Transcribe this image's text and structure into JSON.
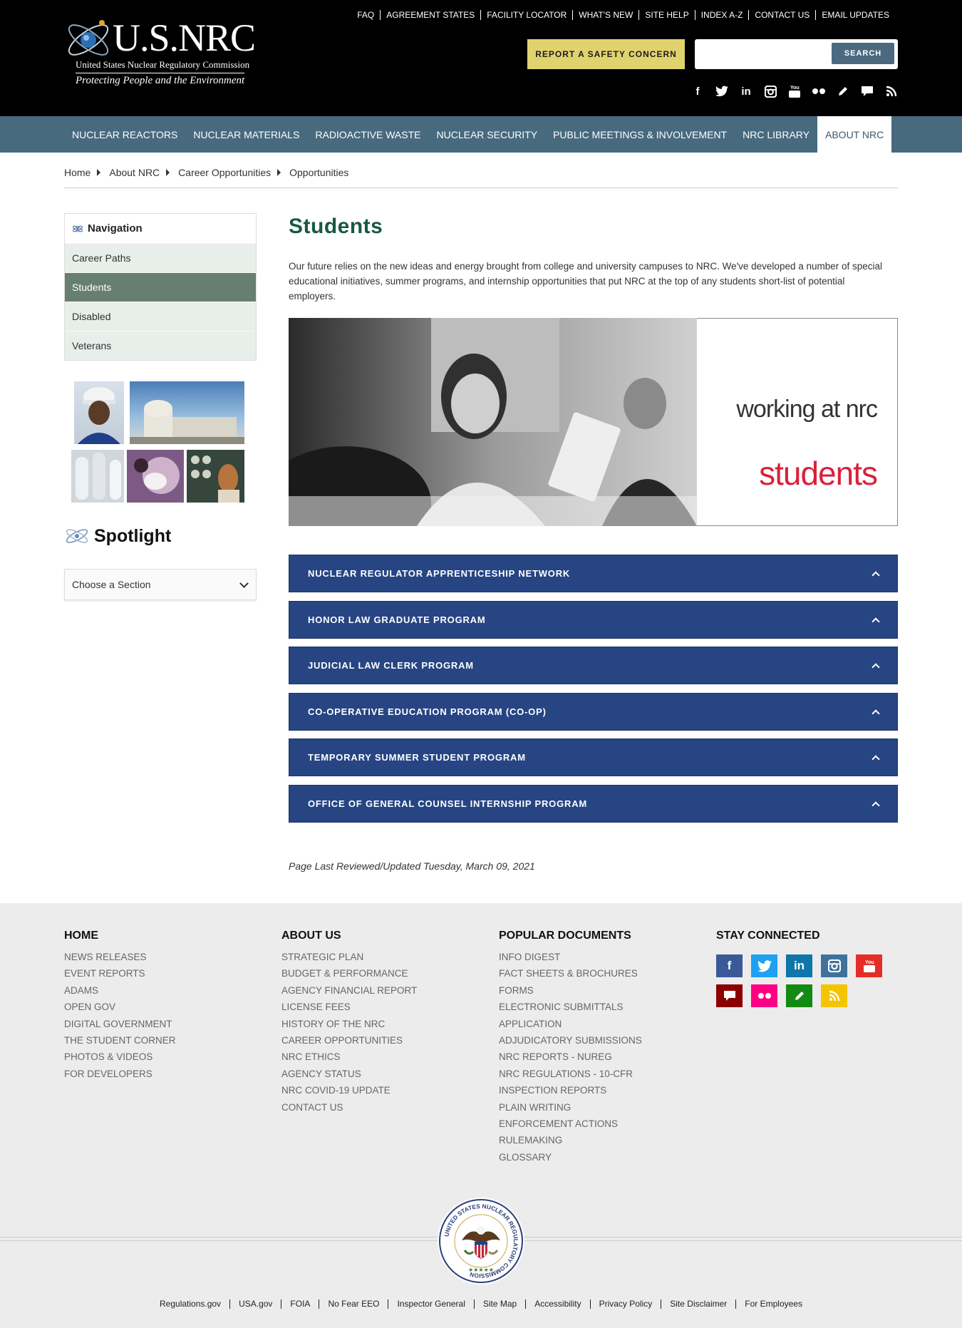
{
  "logo": {
    "title": "U.S.NRC",
    "subtitle": "United States Nuclear Regulatory Commission",
    "tagline": "Protecting People and the Environment"
  },
  "utility_links": [
    "FAQ",
    "AGREEMENT STATES",
    "FACILITY LOCATOR",
    "WHAT'S NEW",
    "SITE HELP",
    "INDEX A-Z",
    "CONTACT US",
    "EMAIL UPDATES"
  ],
  "report_button": "REPORT A SAFETY CONCERN",
  "search": {
    "placeholder": "",
    "button": "SEARCH"
  },
  "social_top_icons": [
    "facebook-icon",
    "twitter-icon",
    "linkedin-icon",
    "instagram-icon",
    "youtube-icon",
    "flickr-icon",
    "blog-icon",
    "comment-icon",
    "rss-icon"
  ],
  "main_nav": [
    "NUCLEAR REACTORS",
    "NUCLEAR MATERIALS",
    "RADIOACTIVE WASTE",
    "NUCLEAR SECURITY",
    "PUBLIC MEETINGS & INVOLVEMENT",
    "NRC LIBRARY",
    "ABOUT NRC"
  ],
  "main_nav_active": "ABOUT NRC",
  "breadcrumb": [
    "Home",
    "About NRC",
    "Career Opportunities",
    "Opportunities"
  ],
  "sidebar": {
    "heading": "Navigation",
    "items": [
      "Career Paths",
      "Students",
      "Disabled",
      "Veterans"
    ],
    "active": "Students"
  },
  "spotlight": {
    "heading": "Spotlight",
    "select_value": "Choose a Section"
  },
  "page": {
    "title": "Students",
    "intro": "Our future relies on the new ideas and energy brought from college and university campuses to NRC. We've developed a number of special educational initiatives, summer programs, and internship opportunities that put NRC at the top of any students short-list of potential employers.",
    "hero_line1": "working at nrc",
    "hero_line2": "students",
    "accordions": [
      "NUCLEAR REGULATOR APPRENTICESHIP NETWORK",
      "HONOR LAW GRADUATE PROGRAM",
      "JUDICIAL LAW CLERK PROGRAM",
      "CO-OPERATIVE EDUCATION PROGRAM (CO-OP)",
      "TEMPORARY SUMMER STUDENT PROGRAM",
      "OFFICE OF GENERAL COUNSEL INTERNSHIP PROGRAM"
    ],
    "last_reviewed": "Page Last Reviewed/Updated Tuesday, March 09, 2021"
  },
  "footer": {
    "columns": [
      {
        "heading": "HOME",
        "links": [
          "NEWS RELEASES",
          "EVENT REPORTS",
          "ADAMS",
          "OPEN GOV",
          "DIGITAL GOVERNMENT",
          "THE STUDENT CORNER",
          "PHOTOS & VIDEOS",
          "FOR DEVELOPERS"
        ]
      },
      {
        "heading": "ABOUT US",
        "links": [
          "STRATEGIC PLAN",
          "BUDGET & PERFORMANCE",
          "AGENCY FINANCIAL REPORT",
          "LICENSE FEES",
          "HISTORY OF THE NRC",
          "CAREER OPPORTUNITIES",
          "NRC ETHICS",
          "AGENCY STATUS",
          "NRC COVID-19 UPDATE",
          "CONTACT US"
        ]
      },
      {
        "heading": "POPULAR DOCUMENTS",
        "links": [
          "INFO DIGEST",
          "FACT SHEETS & BROCHURES",
          "FORMS",
          "ELECTRONIC SUBMITTALS",
          "APPLICATION",
          "ADJUDICATORY SUBMISSIONS",
          "NRC REPORTS - NUREG",
          "NRC REGULATIONS - 10-CFR",
          "INSPECTION REPORTS",
          "PLAIN WRITING",
          "ENFORCEMENT ACTIONS",
          "RULEMAKING",
          "GLOSSARY"
        ]
      },
      {
        "heading": "STAY CONNECTED",
        "links": []
      }
    ],
    "social_colors": {
      "facebook": "#3b5998",
      "twitter": "#1da1f2",
      "linkedin": "#0e76a8",
      "instagram": "#3f729b",
      "youtube": "#e52d27",
      "comment": "#8b0000",
      "flickr": "#ff0084",
      "blog": "#138a13",
      "rss": "#f5c400"
    },
    "seal_text": "UNITED STATES NUCLEAR REGULATORY COMMISSION",
    "bottom_links": [
      "Regulations.gov",
      "USA.gov",
      "FOIA",
      "No Fear EEO",
      "Inspector General",
      "Site Map",
      "Accessibility",
      "Privacy Policy",
      "Site Disclaimer",
      "For Employees"
    ]
  },
  "colors": {
    "header_bg": "#000000",
    "nav_bg": "#476a7f",
    "title_green": "#19593f",
    "accordion_blue": "#274583",
    "report_yellow": "#e0d36e",
    "sidebar_active": "#677f6e",
    "hero_red": "#d9213a"
  }
}
